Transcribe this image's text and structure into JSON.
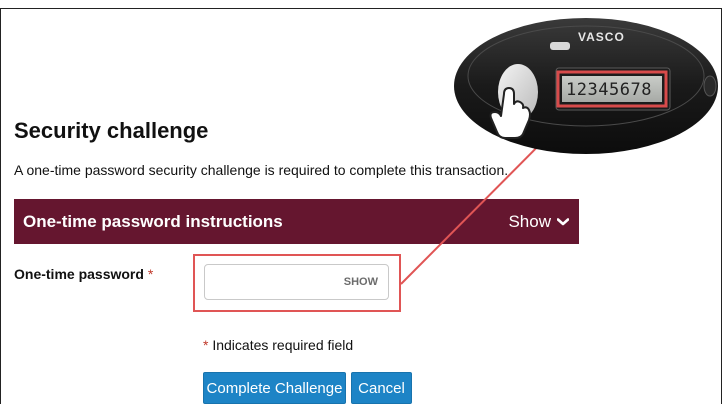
{
  "page": {
    "title": "Security challenge",
    "intro": "A one-time password security challenge is required to complete this transaction."
  },
  "instructions_banner": {
    "title": "One-time password instructions",
    "toggle_label": "Show",
    "toggle_icon": "chevron-down-icon",
    "color": "#65162f"
  },
  "otp_field": {
    "label": "One-time password",
    "required_marker": "*",
    "value": "",
    "show_label": "SHOW"
  },
  "required_note": {
    "marker": "*",
    "text": "Indicates required field"
  },
  "buttons": {
    "complete": "Complete Challenge",
    "cancel": "Cancel",
    "color": "#1d84c6"
  },
  "token": {
    "brand": "VASCO",
    "display_code": "12345678",
    "highlight_color": "#e05555"
  }
}
